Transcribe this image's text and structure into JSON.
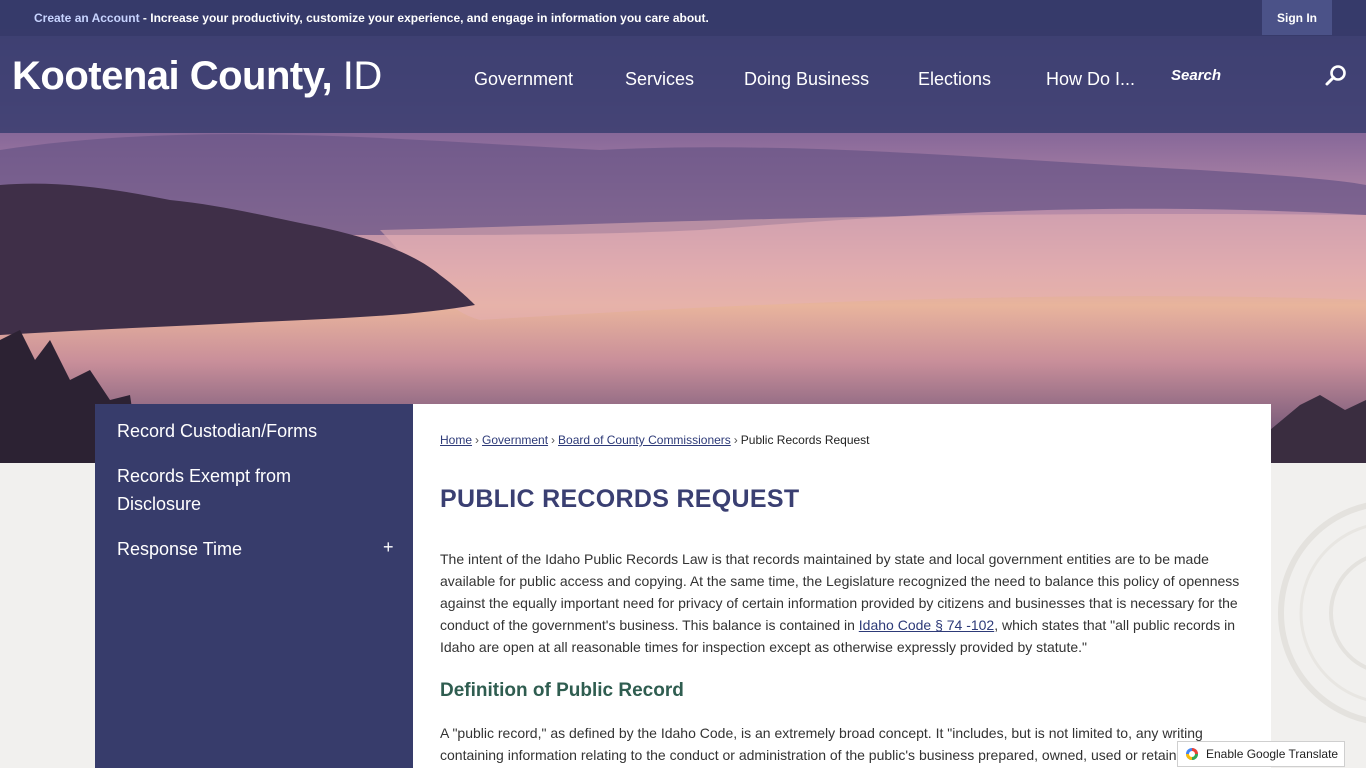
{
  "topbar": {
    "create_account": "Create an Account",
    "message": " - Increase your productivity, customize your experience, and engage in information you care about.",
    "sign_in": "Sign In"
  },
  "header": {
    "logo_main": "Kootenai County,",
    "logo_state": "ID",
    "nav": [
      "Government",
      "Services",
      "Doing Business",
      "Elections",
      "How Do I..."
    ],
    "search_placeholder": "Search"
  },
  "sidebar": {
    "items": [
      "Record Custodian/Forms",
      "Records Exempt from Disclosure",
      "Response Time"
    ],
    "expand_symbol": "+"
  },
  "breadcrumb": {
    "items": [
      "Home",
      "Government",
      "Board of County Commissioners"
    ],
    "current": "Public Records Request",
    "separator": "›"
  },
  "main": {
    "title": "PUBLIC RECORDS REQUEST",
    "intro_before_link": "The intent of the Idaho Public Records Law is that records maintained by state and local government entities are to be made available for public access and copying. At the same time, the Legislature recognized the need to balance this policy of openness against the equally important need for privacy of certain information provided by citizens and businesses that is necessary for the conduct of the government's business. This balance is contained in ",
    "intro_link": "Idaho Code § 74 -102",
    "intro_after_link": ", which states that \"all public records in Idaho are open at all reasonable times for inspection except as otherwise expressly provided by statute.\"",
    "section_title": "Definition of Public Record",
    "definition": "A \"public record,\" as defined by the Idaho Code, is an extremely broad concept. It \"includes, but is not limited to, any writing containing information relating to the conduct or administration of the public's business prepared, owned, used or retained by any state"
  },
  "translate": {
    "label": "Enable Google Translate"
  },
  "colors": {
    "navy": "#373c6b",
    "title": "#3a3f72",
    "section": "#2f5d50"
  }
}
